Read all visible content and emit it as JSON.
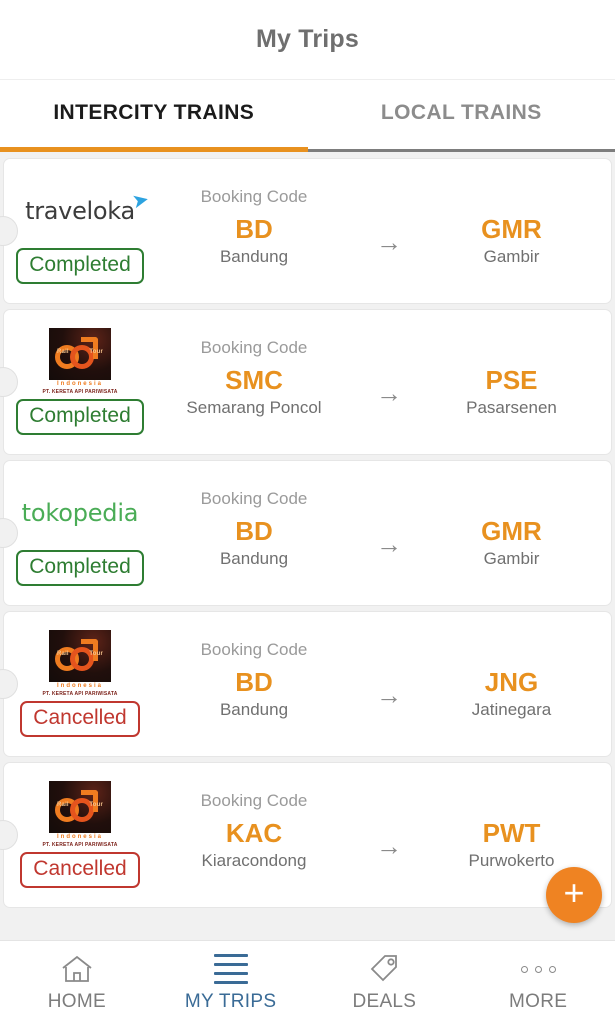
{
  "header": {
    "title": "My Trips"
  },
  "tabs": [
    {
      "label": "INTERCITY TRAINS",
      "active": true
    },
    {
      "label": "LOCAL TRAINS",
      "active": false
    }
  ],
  "labels": {
    "booking_code": "Booking Code",
    "arrow": "→"
  },
  "colors": {
    "accent_orange": "#e8911f",
    "fab_orange": "#ef8322",
    "completed_green": "#2e7d32",
    "cancelled_red": "#c0372f",
    "active_nav_blue": "#3a6b96",
    "muted_gray": "#707070"
  },
  "railtour_logo": {
    "word_left": "Rail",
    "word_right": "Tour",
    "country": "Indonesia",
    "caption": "PT. KERETA API PARIWISATA"
  },
  "trips": [
    {
      "provider": "traveloka",
      "provider_logo": "traveloka-logo",
      "booking_code_label": "Booking Code",
      "origin_code": "BD",
      "origin_name": "Bandung",
      "dest_code": "GMR",
      "dest_name": "Gambir",
      "status": "Completed",
      "status_type": "completed"
    },
    {
      "provider": "Rail Tour Indonesia",
      "provider_logo": "railtour-logo",
      "booking_code_label": "Booking Code",
      "origin_code": "SMC",
      "origin_name": "Semarang Poncol",
      "dest_code": "PSE",
      "dest_name": "Pasarsenen",
      "status": "Completed",
      "status_type": "completed"
    },
    {
      "provider": "tokopedia",
      "provider_logo": "tokopedia-logo",
      "booking_code_label": "Booking Code",
      "origin_code": "BD",
      "origin_name": "Bandung",
      "dest_code": "GMR",
      "dest_name": "Gambir",
      "status": "Completed",
      "status_type": "completed"
    },
    {
      "provider": "Rail Tour Indonesia",
      "provider_logo": "railtour-logo",
      "booking_code_label": "Booking Code",
      "origin_code": "BD",
      "origin_name": "Bandung",
      "dest_code": "JNG",
      "dest_name": "Jatinegara",
      "status": "Cancelled",
      "status_type": "cancelled"
    },
    {
      "provider": "Rail Tour Indonesia",
      "provider_logo": "railtour-logo",
      "booking_code_label": "Booking Code",
      "origin_code": "KAC",
      "origin_name": "Kiaracondong",
      "dest_code": "PWT",
      "dest_name": "Purwokerto",
      "status": "Cancelled",
      "status_type": "cancelled"
    }
  ],
  "fab": {
    "label": "+",
    "icon": "plus-icon"
  },
  "bottom_nav": [
    {
      "label": "HOME",
      "icon": "home-icon",
      "active": false
    },
    {
      "label": "MY TRIPS",
      "icon": "list-icon",
      "active": true
    },
    {
      "label": "DEALS",
      "icon": "tag-icon",
      "active": false
    },
    {
      "label": "MORE",
      "icon": "more-dots-icon",
      "active": false
    }
  ]
}
